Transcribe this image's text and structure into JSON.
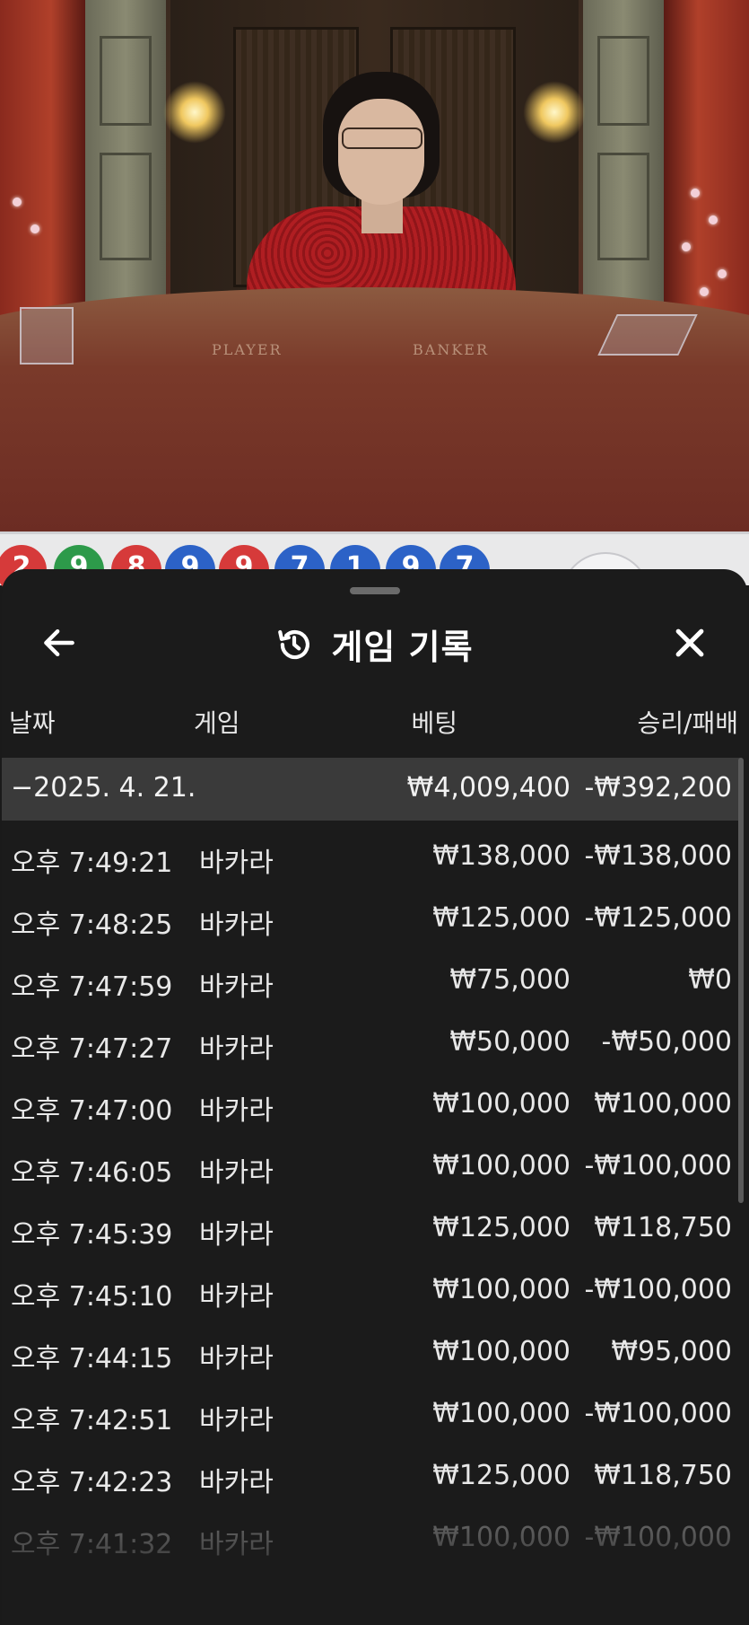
{
  "video": {
    "table_labels": [
      "PLAYER",
      "BANKER"
    ]
  },
  "road": {
    "beads": [
      {
        "value": "2",
        "color": "red"
      },
      {
        "value": "9",
        "color": "green"
      },
      {
        "value": "8",
        "color": "red"
      },
      {
        "value": "9",
        "color": "blue"
      },
      {
        "value": "9",
        "color": "red"
      },
      {
        "value": "7",
        "color": "blue"
      },
      {
        "value": "1",
        "color": "blue"
      },
      {
        "value": "9",
        "color": "blue"
      },
      {
        "value": "7",
        "color": "blue"
      }
    ]
  },
  "sheet": {
    "title": "게임 기록",
    "icons": {
      "back": "arrow-left-icon",
      "history": "history-icon",
      "close": "close-icon"
    },
    "columns": {
      "date": "날짜",
      "game": "게임",
      "bet": "베팅",
      "result": "승리/패배"
    },
    "day": {
      "date": "−2025. 4. 21.",
      "bet": "₩4,009,400",
      "result": "-₩392,200"
    },
    "rows": [
      {
        "time": "오후 7:49:21",
        "game": "바카라",
        "bet": "₩138,000",
        "result": "-₩138,000"
      },
      {
        "time": "오후 7:48:25",
        "game": "바카라",
        "bet": "₩125,000",
        "result": "-₩125,000"
      },
      {
        "time": "오후 7:47:59",
        "game": "바카라",
        "bet": "₩75,000",
        "result": "₩0"
      },
      {
        "time": "오후 7:47:27",
        "game": "바카라",
        "bet": "₩50,000",
        "result": "-₩50,000"
      },
      {
        "time": "오후 7:47:00",
        "game": "바카라",
        "bet": "₩100,000",
        "result": "₩100,000"
      },
      {
        "time": "오후 7:46:05",
        "game": "바카라",
        "bet": "₩100,000",
        "result": "-₩100,000"
      },
      {
        "time": "오후 7:45:39",
        "game": "바카라",
        "bet": "₩125,000",
        "result": "₩118,750"
      },
      {
        "time": "오후 7:45:10",
        "game": "바카라",
        "bet": "₩100,000",
        "result": "-₩100,000"
      },
      {
        "time": "오후 7:44:15",
        "game": "바카라",
        "bet": "₩100,000",
        "result": "₩95,000"
      },
      {
        "time": "오후 7:42:51",
        "game": "바카라",
        "bet": "₩100,000",
        "result": "-₩100,000"
      },
      {
        "time": "오후 7:42:23",
        "game": "바카라",
        "bet": "₩125,000",
        "result": "₩118,750"
      },
      {
        "time": "오후 7:41:32",
        "game": "바카라",
        "bet": "₩100,000",
        "result": "-₩100,000"
      }
    ]
  }
}
